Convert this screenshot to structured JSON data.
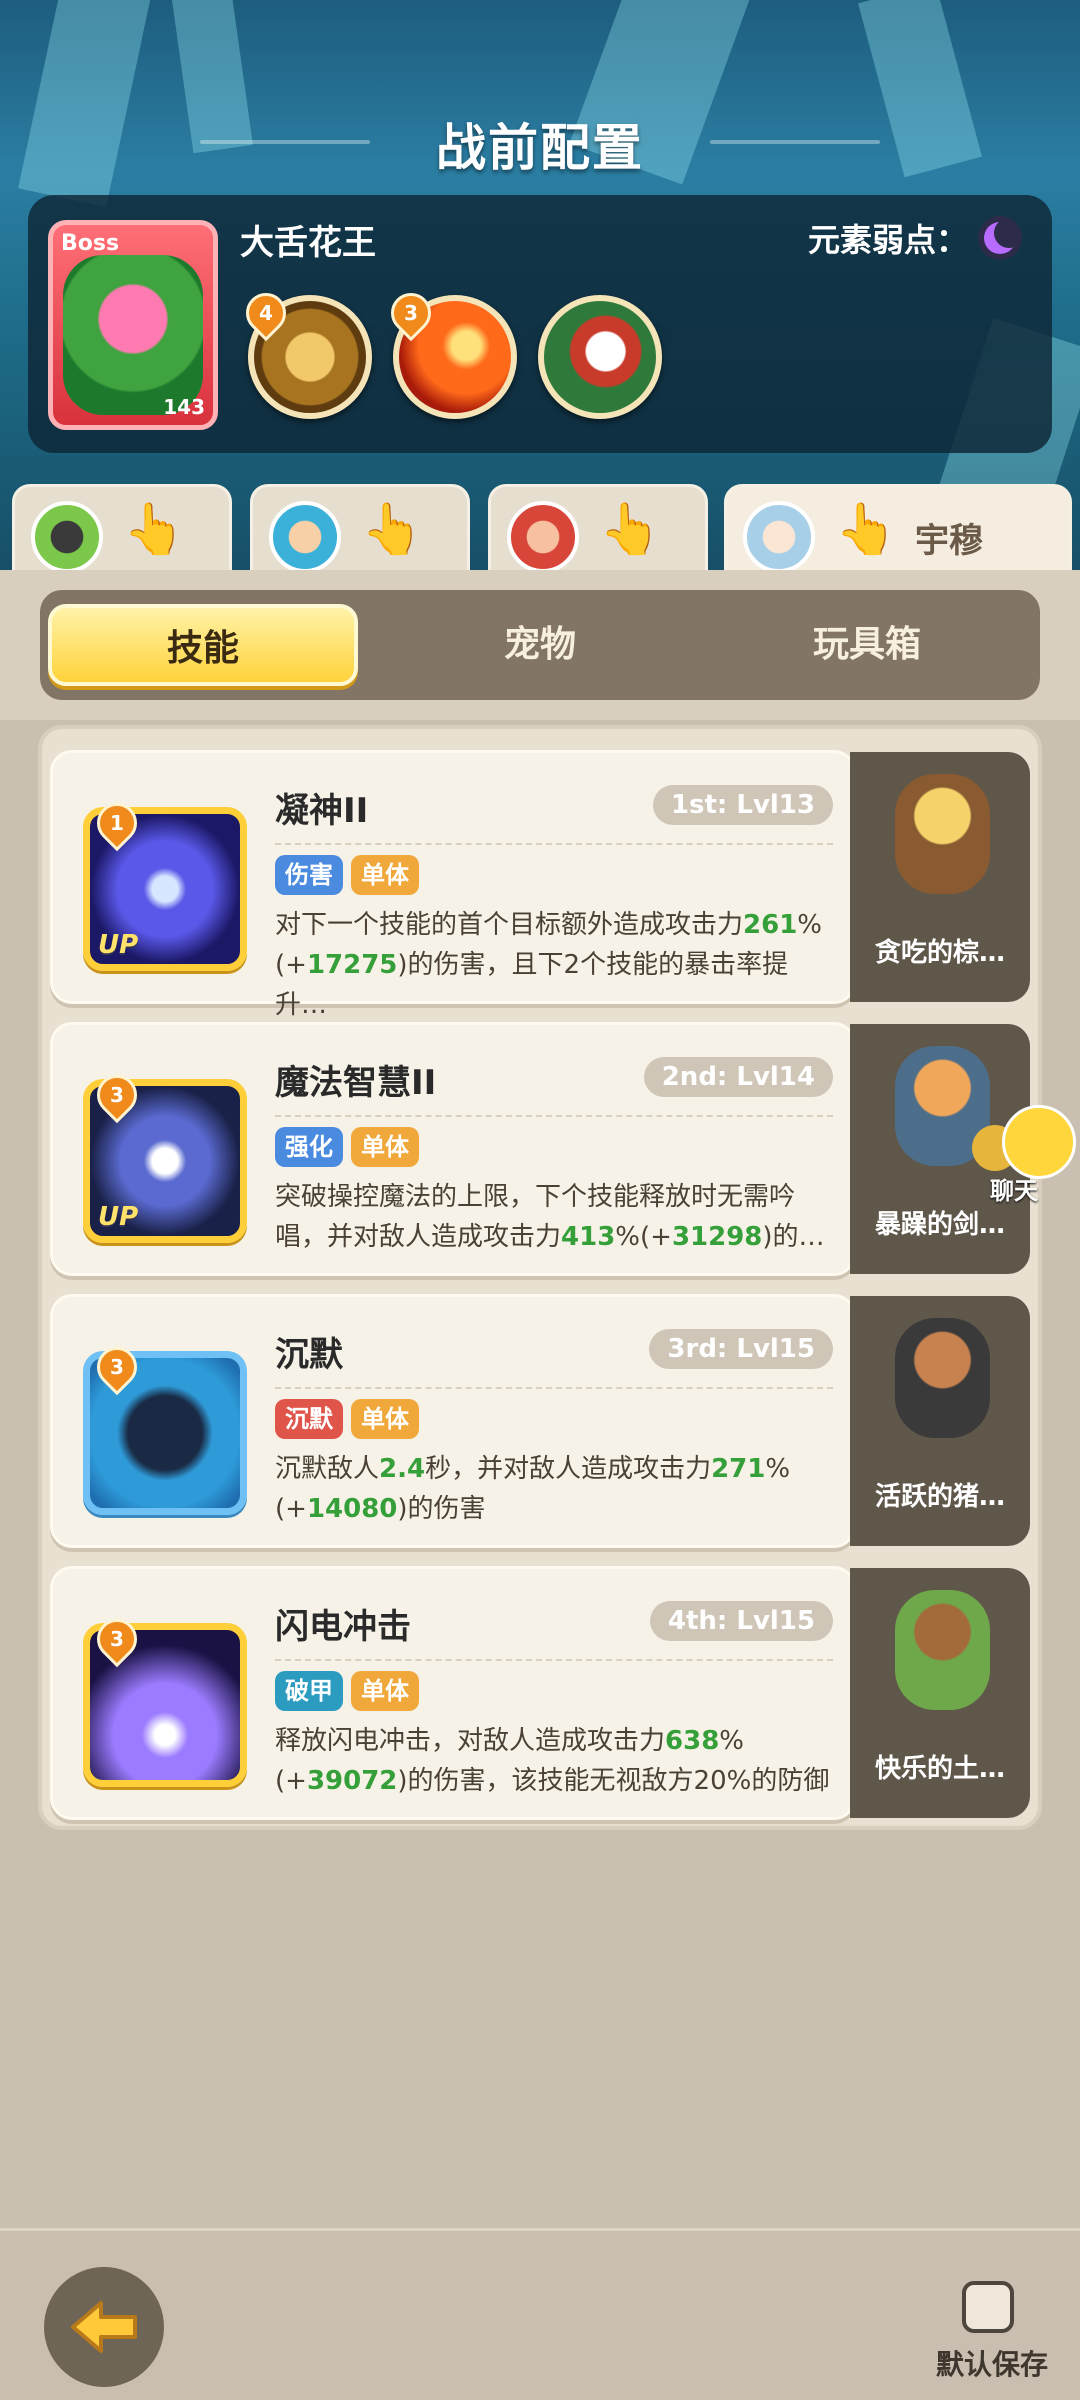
{
  "screen_title": "战前配置",
  "boss": {
    "tag": "Boss",
    "name": "大舌花王",
    "level": "143",
    "weakness_label": "元素弱点：",
    "weakness_icon": "moon-icon",
    "skills": [
      {
        "badge": "4",
        "icon": "boss-skill-shield-icon"
      },
      {
        "badge": "3",
        "icon": "boss-skill-fire-icon"
      },
      {
        "badge": "",
        "icon": "boss-skill-rock-icon"
      }
    ]
  },
  "hero_tabs": [
    {
      "name": ""
    },
    {
      "name": ""
    },
    {
      "name": ""
    },
    {
      "name": "宇穆"
    }
  ],
  "category_tabs": [
    {
      "label": "技能",
      "active": true
    },
    {
      "label": "宠物",
      "active": false
    },
    {
      "label": "玩具箱",
      "active": false
    }
  ],
  "skills": [
    {
      "badge": "1",
      "name": "凝神II",
      "level": "1st: Lvl13",
      "up": "UP",
      "tags": [
        {
          "label": "伤害",
          "color": "#4a8be0"
        },
        {
          "label": "单体",
          "color": "#f0a83a"
        }
      ],
      "desc": [
        "对下一个技能的首个目标额外造成攻击力",
        "261",
        "%(+",
        "17275",
        ")的伤害，且下2个技能的暴击率提升…"
      ],
      "pet": {
        "name": "贪吃的棕…"
      }
    },
    {
      "badge": "3",
      "name": "魔法智慧II",
      "level": "2nd: Lvl14",
      "up": "UP",
      "tags": [
        {
          "label": "强化",
          "color": "#4a8be0"
        },
        {
          "label": "单体",
          "color": "#f0a83a"
        }
      ],
      "desc": [
        "突破操控魔法的上限，下个技能释放时无需吟唱，并对敌人造成攻击力",
        "413",
        "%(+",
        "31298",
        ")的…"
      ],
      "pet": {
        "name": "暴躁的剑…"
      }
    },
    {
      "badge": "3",
      "name": "沉默",
      "level": "3rd: Lvl15",
      "up": "",
      "tags": [
        {
          "label": "沉默",
          "color": "#e0554a"
        },
        {
          "label": "单体",
          "color": "#f0a83a"
        }
      ],
      "desc": [
        "沉默敌人",
        "2.4",
        "秒，并对敌人造成攻击力",
        "271",
        "%(+",
        "14080",
        ")的伤害"
      ],
      "pet": {
        "name": "活跃的猪…"
      }
    },
    {
      "badge": "3",
      "name": "闪电冲击",
      "level": "4th: Lvl15",
      "up": "",
      "tags": [
        {
          "label": "破甲",
          "color": "#2b9bbf"
        },
        {
          "label": "单体",
          "color": "#f0a83a"
        }
      ],
      "desc": [
        "释放闪电冲击，对敌人造成攻击力",
        "638",
        "%(+",
        "39072",
        ")的伤害，该技能无视敌方20%的防御"
      ],
      "pet": {
        "name": "快乐的土…"
      }
    }
  ],
  "chat": {
    "label": "聊天"
  },
  "footer": {
    "save_label": "默认保存"
  }
}
